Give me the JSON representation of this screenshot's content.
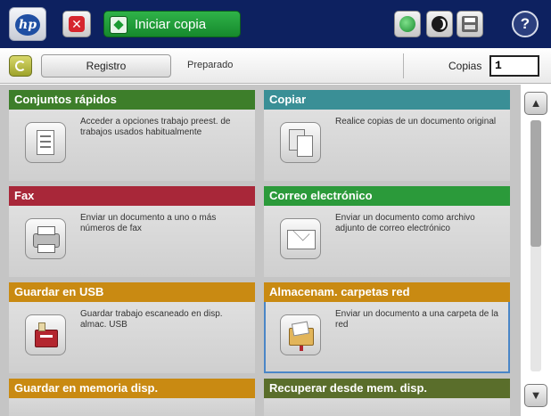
{
  "header": {
    "start_label": "Iniciar copia",
    "stop_glyph": "✕",
    "help_glyph": "?",
    "logo_text": "hp",
    "icons": [
      "hp-logo-icon",
      "stop-icon",
      "start-copy-icon",
      "network-status-icon",
      "sleep-icon",
      "printer-status-icon",
      "help-icon"
    ]
  },
  "status": {
    "registro_label": "Registro",
    "state_text": "Preparado",
    "copies_label": "Copias",
    "copies_value": "1"
  },
  "tiles": [
    {
      "title": "Conjuntos rápidos",
      "desc": "Acceder a opciones trabajo preest. de trabajos usados habitualmente",
      "color": "#3d7e2a",
      "icon": "quick-sets-icon"
    },
    {
      "title": "Copiar",
      "desc": "Realice copias de un documento original",
      "color": "#3a8f96",
      "icon": "copy-icon"
    },
    {
      "title": "Fax",
      "desc": "Enviar un documento a uno o más números de fax",
      "color": "#a82739",
      "icon": "fax-icon"
    },
    {
      "title": "Correo electrónico",
      "desc": "Enviar un documento como archivo adjunto de correo electrónico",
      "color": "#2b9a3a",
      "icon": "email-icon"
    },
    {
      "title": "Guardar en USB",
      "desc": "Guardar trabajo escaneado en disp. almac. USB",
      "color": "#c98a12",
      "icon": "usb-icon"
    },
    {
      "title": "Almacenam. carpetas red",
      "desc": "Enviar un documento a una carpeta de la red",
      "color": "#c98a12",
      "icon": "network-folder-icon"
    },
    {
      "title": "Guardar en memoria disp.",
      "desc": "",
      "color": "#c98a12",
      "icon": "device-memory-icon"
    },
    {
      "title": "Recuperar desde mem. disp.",
      "desc": "",
      "color": "#5a6e2b",
      "icon": "retrieve-memory-icon"
    }
  ],
  "scroll": {
    "up_glyph": "▲",
    "down_glyph": "▼",
    "position_fraction": 0.0
  }
}
